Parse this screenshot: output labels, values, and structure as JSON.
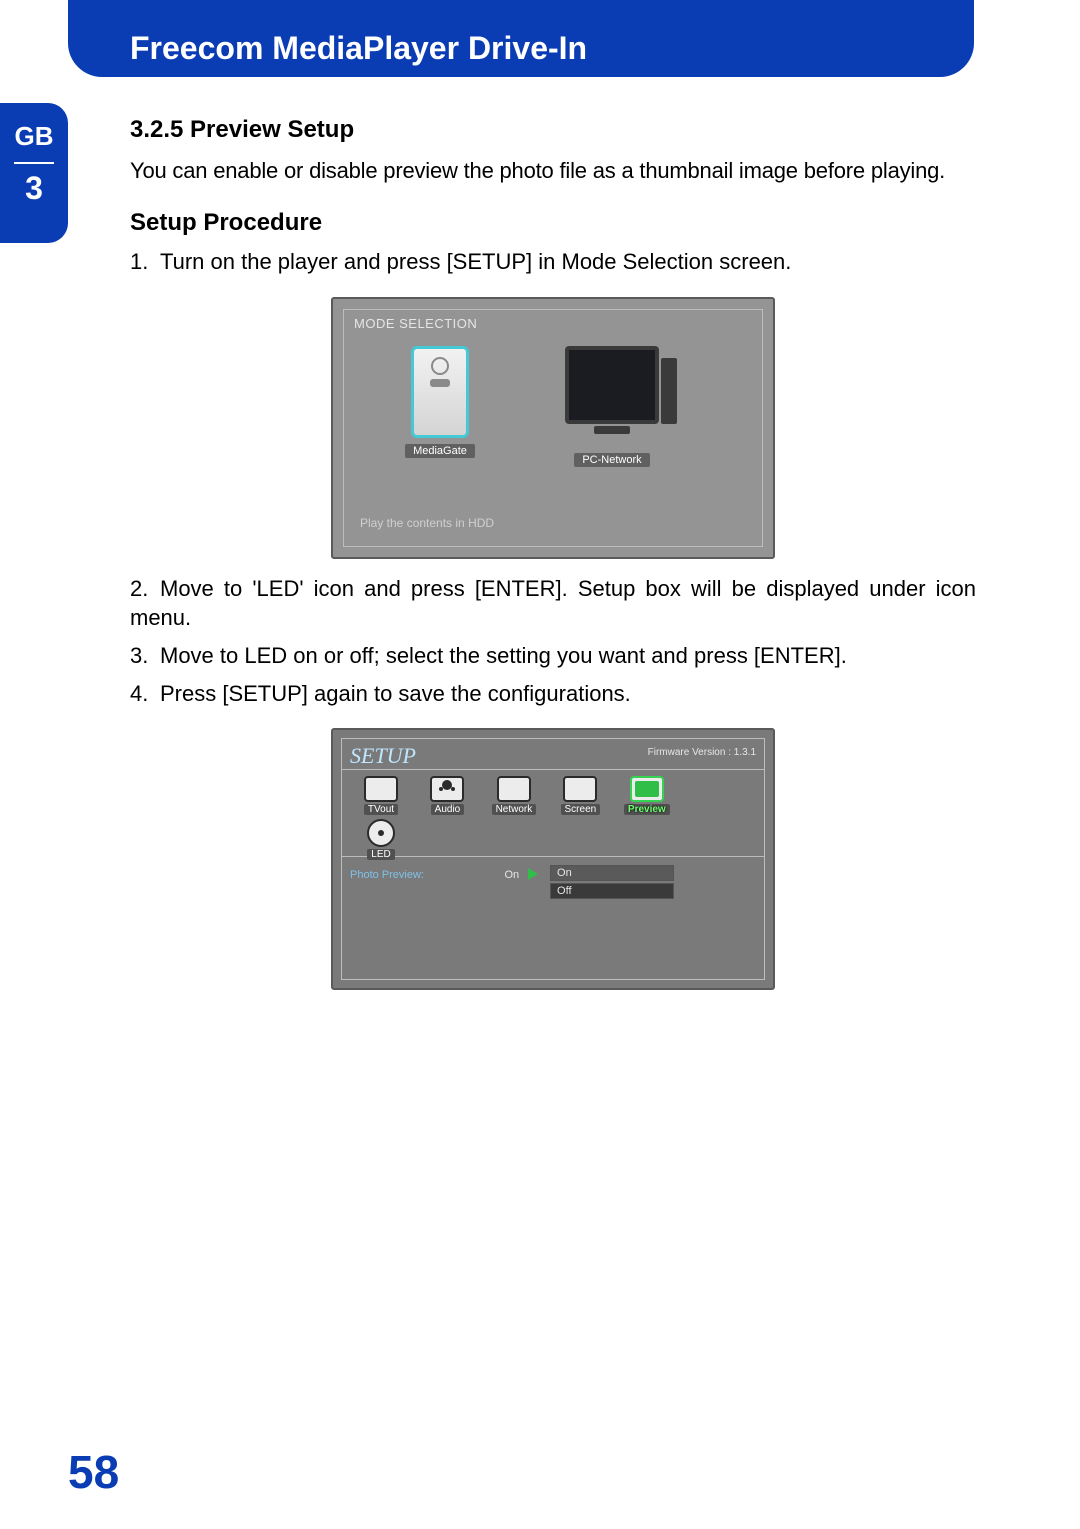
{
  "header": {
    "title": "Freecom MediaPlayer Drive-In"
  },
  "sidebar": {
    "language": "GB",
    "chapter": "3"
  },
  "section": {
    "heading": "3.2.5 Preview Setup",
    "intro": "You can enable or disable preview the photo file as a thumbnail image before playing.",
    "procedure_label": "Setup Procedure",
    "steps": [
      "Turn on the player and press [SETUP] in Mode Selection screen.",
      "Move to 'LED' icon and press [ENTER]. Setup box will be displayed under icon menu.",
      "Move to LED on or off; select the setting you want and press [ENTER].",
      "Press [SETUP] again to save the configurations."
    ]
  },
  "figure1": {
    "title": "MODE SELECTION",
    "option_left": "MediaGate",
    "option_right": "PC-Network",
    "footer": "Play the contents in HDD"
  },
  "figure2": {
    "title": "SETUP",
    "firmware": "Firmware Version : 1.3.1",
    "tabs": {
      "tvout": "TVout",
      "audio": "Audio",
      "network": "Network",
      "screen": "Screen",
      "preview": "Preview",
      "led": "LED"
    },
    "row_label": "Photo Preview:",
    "current_value": "On",
    "options": [
      "On",
      "Off"
    ]
  },
  "page_number": "58"
}
